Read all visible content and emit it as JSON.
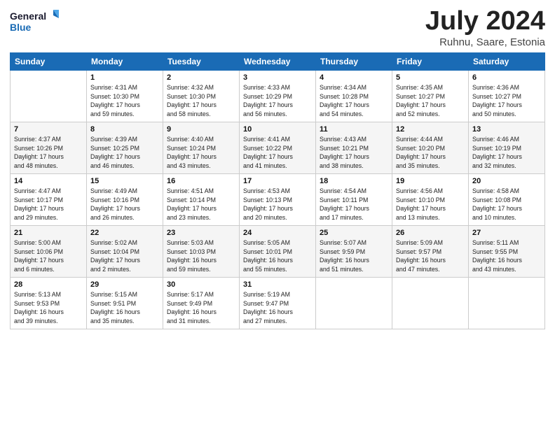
{
  "logo": {
    "line1": "General",
    "line2": "Blue"
  },
  "title": "July 2024",
  "subtitle": "Ruhnu, Saare, Estonia",
  "header_days": [
    "Sunday",
    "Monday",
    "Tuesday",
    "Wednesday",
    "Thursday",
    "Friday",
    "Saturday"
  ],
  "weeks": [
    [
      {
        "day": "",
        "detail": ""
      },
      {
        "day": "1",
        "detail": "Sunrise: 4:31 AM\nSunset: 10:30 PM\nDaylight: 17 hours\nand 59 minutes."
      },
      {
        "day": "2",
        "detail": "Sunrise: 4:32 AM\nSunset: 10:30 PM\nDaylight: 17 hours\nand 58 minutes."
      },
      {
        "day": "3",
        "detail": "Sunrise: 4:33 AM\nSunset: 10:29 PM\nDaylight: 17 hours\nand 56 minutes."
      },
      {
        "day": "4",
        "detail": "Sunrise: 4:34 AM\nSunset: 10:28 PM\nDaylight: 17 hours\nand 54 minutes."
      },
      {
        "day": "5",
        "detail": "Sunrise: 4:35 AM\nSunset: 10:27 PM\nDaylight: 17 hours\nand 52 minutes."
      },
      {
        "day": "6",
        "detail": "Sunrise: 4:36 AM\nSunset: 10:27 PM\nDaylight: 17 hours\nand 50 minutes."
      }
    ],
    [
      {
        "day": "7",
        "detail": "Sunrise: 4:37 AM\nSunset: 10:26 PM\nDaylight: 17 hours\nand 48 minutes."
      },
      {
        "day": "8",
        "detail": "Sunrise: 4:39 AM\nSunset: 10:25 PM\nDaylight: 17 hours\nand 46 minutes."
      },
      {
        "day": "9",
        "detail": "Sunrise: 4:40 AM\nSunset: 10:24 PM\nDaylight: 17 hours\nand 43 minutes."
      },
      {
        "day": "10",
        "detail": "Sunrise: 4:41 AM\nSunset: 10:22 PM\nDaylight: 17 hours\nand 41 minutes."
      },
      {
        "day": "11",
        "detail": "Sunrise: 4:43 AM\nSunset: 10:21 PM\nDaylight: 17 hours\nand 38 minutes."
      },
      {
        "day": "12",
        "detail": "Sunrise: 4:44 AM\nSunset: 10:20 PM\nDaylight: 17 hours\nand 35 minutes."
      },
      {
        "day": "13",
        "detail": "Sunrise: 4:46 AM\nSunset: 10:19 PM\nDaylight: 17 hours\nand 32 minutes."
      }
    ],
    [
      {
        "day": "14",
        "detail": "Sunrise: 4:47 AM\nSunset: 10:17 PM\nDaylight: 17 hours\nand 29 minutes."
      },
      {
        "day": "15",
        "detail": "Sunrise: 4:49 AM\nSunset: 10:16 PM\nDaylight: 17 hours\nand 26 minutes."
      },
      {
        "day": "16",
        "detail": "Sunrise: 4:51 AM\nSunset: 10:14 PM\nDaylight: 17 hours\nand 23 minutes."
      },
      {
        "day": "17",
        "detail": "Sunrise: 4:53 AM\nSunset: 10:13 PM\nDaylight: 17 hours\nand 20 minutes."
      },
      {
        "day": "18",
        "detail": "Sunrise: 4:54 AM\nSunset: 10:11 PM\nDaylight: 17 hours\nand 17 minutes."
      },
      {
        "day": "19",
        "detail": "Sunrise: 4:56 AM\nSunset: 10:10 PM\nDaylight: 17 hours\nand 13 minutes."
      },
      {
        "day": "20",
        "detail": "Sunrise: 4:58 AM\nSunset: 10:08 PM\nDaylight: 17 hours\nand 10 minutes."
      }
    ],
    [
      {
        "day": "21",
        "detail": "Sunrise: 5:00 AM\nSunset: 10:06 PM\nDaylight: 17 hours\nand 6 minutes."
      },
      {
        "day": "22",
        "detail": "Sunrise: 5:02 AM\nSunset: 10:04 PM\nDaylight: 17 hours\nand 2 minutes."
      },
      {
        "day": "23",
        "detail": "Sunrise: 5:03 AM\nSunset: 10:03 PM\nDaylight: 16 hours\nand 59 minutes."
      },
      {
        "day": "24",
        "detail": "Sunrise: 5:05 AM\nSunset: 10:01 PM\nDaylight: 16 hours\nand 55 minutes."
      },
      {
        "day": "25",
        "detail": "Sunrise: 5:07 AM\nSunset: 9:59 PM\nDaylight: 16 hours\nand 51 minutes."
      },
      {
        "day": "26",
        "detail": "Sunrise: 5:09 AM\nSunset: 9:57 PM\nDaylight: 16 hours\nand 47 minutes."
      },
      {
        "day": "27",
        "detail": "Sunrise: 5:11 AM\nSunset: 9:55 PM\nDaylight: 16 hours\nand 43 minutes."
      }
    ],
    [
      {
        "day": "28",
        "detail": "Sunrise: 5:13 AM\nSunset: 9:53 PM\nDaylight: 16 hours\nand 39 minutes."
      },
      {
        "day": "29",
        "detail": "Sunrise: 5:15 AM\nSunset: 9:51 PM\nDaylight: 16 hours\nand 35 minutes."
      },
      {
        "day": "30",
        "detail": "Sunrise: 5:17 AM\nSunset: 9:49 PM\nDaylight: 16 hours\nand 31 minutes."
      },
      {
        "day": "31",
        "detail": "Sunrise: 5:19 AM\nSunset: 9:47 PM\nDaylight: 16 hours\nand 27 minutes."
      },
      {
        "day": "",
        "detail": ""
      },
      {
        "day": "",
        "detail": ""
      },
      {
        "day": "",
        "detail": ""
      }
    ]
  ]
}
